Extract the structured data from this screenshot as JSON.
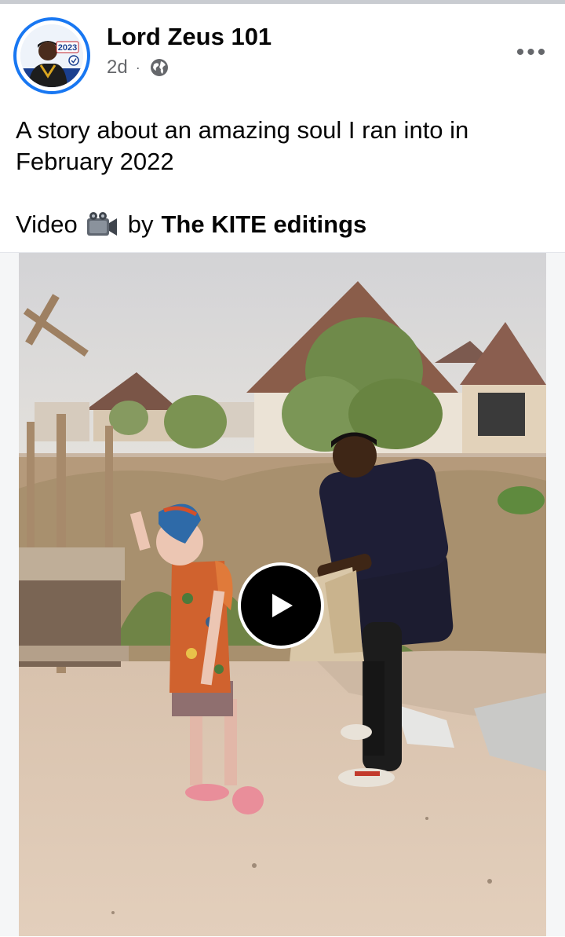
{
  "post": {
    "author": "Lord Zeus 101",
    "time": "2d",
    "separator": "·",
    "privacy_icon": "globe-icon",
    "more_label": "•••",
    "text": "A story about an amazing soul I ran into in February 2022",
    "video_label": "Video",
    "video_icon": "video-camera-icon",
    "by_label": "by",
    "credit": "The KITE editings"
  },
  "avatar": {
    "badge_text": "2023",
    "ring_color": "#1877f2"
  },
  "video": {
    "play_icon": "play-icon"
  },
  "colors": {
    "accent": "#1877f2",
    "secondary_text": "#65676b"
  }
}
